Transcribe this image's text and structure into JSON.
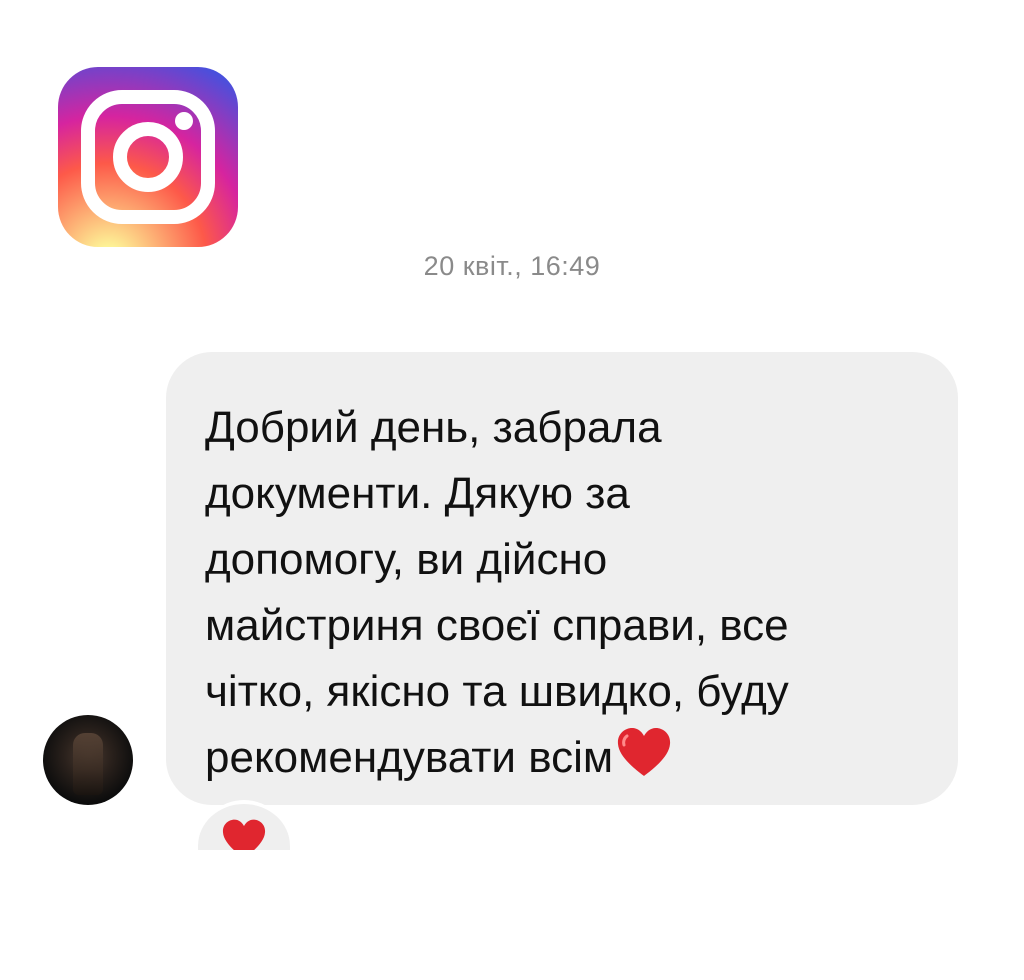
{
  "app": {
    "logo_icon": "instagram-logo-icon"
  },
  "chat": {
    "timestamp": "20 квіт., 16:49",
    "message": {
      "text": "Добрий день, забрала\nдокументи. Дякую за\nдопомогу, ви дійсно\nмайстриня своєї справи, все\nчітко, якісно та швидко, буду\nрекомендувати всім",
      "trailing_emoji": "heart-emoji-icon"
    },
    "sender_avatar": "avatar",
    "reaction": "heart-emoji-icon"
  },
  "colors": {
    "bubble": "#efefef",
    "text": "#111111",
    "timestamp": "#8a8a8a",
    "heart": "#e0262f"
  }
}
